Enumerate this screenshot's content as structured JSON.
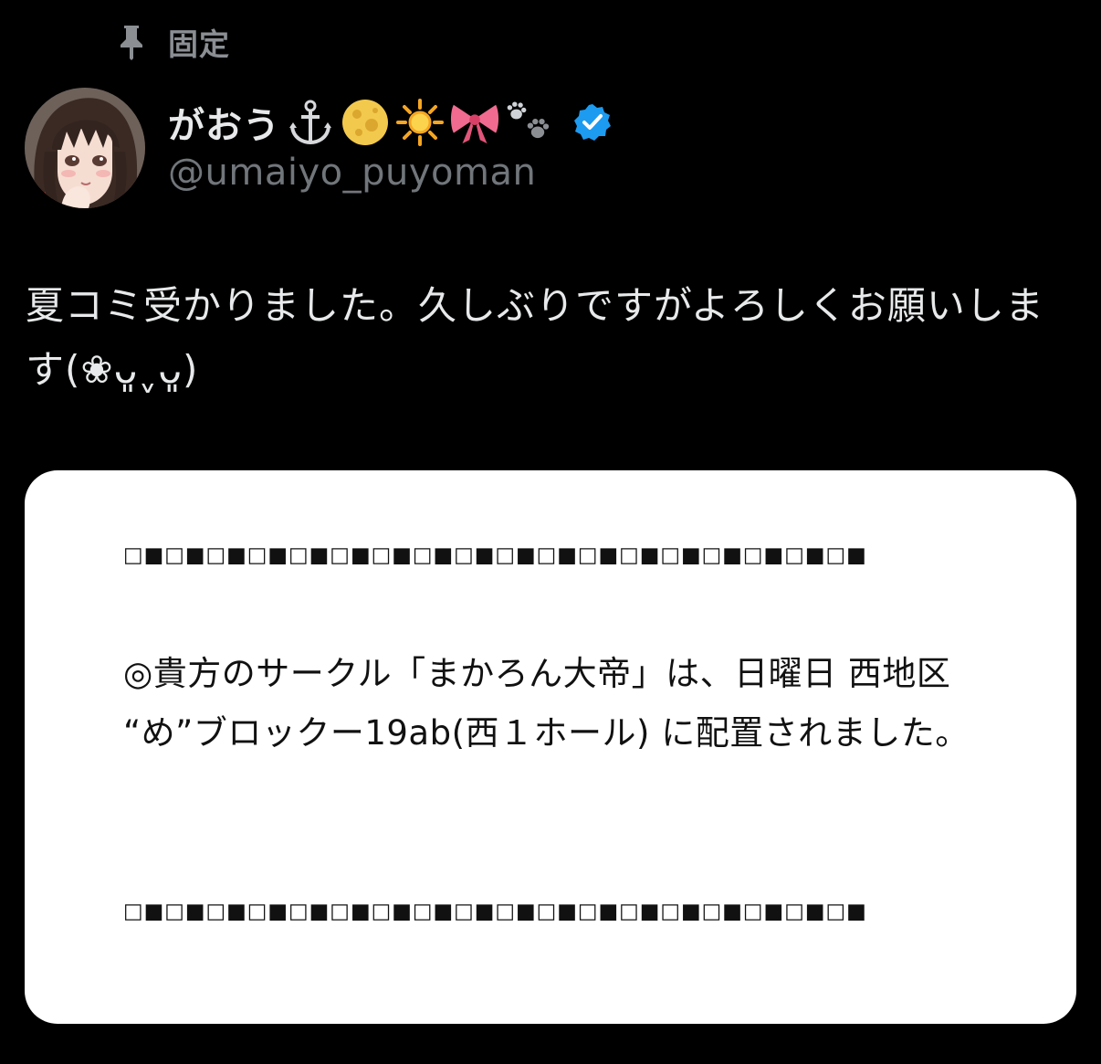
{
  "pinned": {
    "icon": "pin-icon",
    "label": "固定"
  },
  "author": {
    "display_name": "がおう",
    "emojis": [
      "⚓",
      "🌕",
      "🔆",
      "🎀",
      "🐾"
    ],
    "verified": true,
    "handle": "@umaiyo_puyoman",
    "accent_color": "#1d9bf0"
  },
  "tweet": {
    "text": "夏コミ受かりました。久しぶりですがよろしくお願いします(❀ᴗ͈ˬᴗ͈)"
  },
  "attached_image": {
    "border_pattern": "□■□■□■□■□■□■□■□■□■□■□■□■□■□■□■□■□■□■",
    "notice_text": "◎貴方のサークル「まかろん大帝」は、日曜日 西地区 “め”ブロックー19ab(西１ホール) に配置されました。"
  }
}
